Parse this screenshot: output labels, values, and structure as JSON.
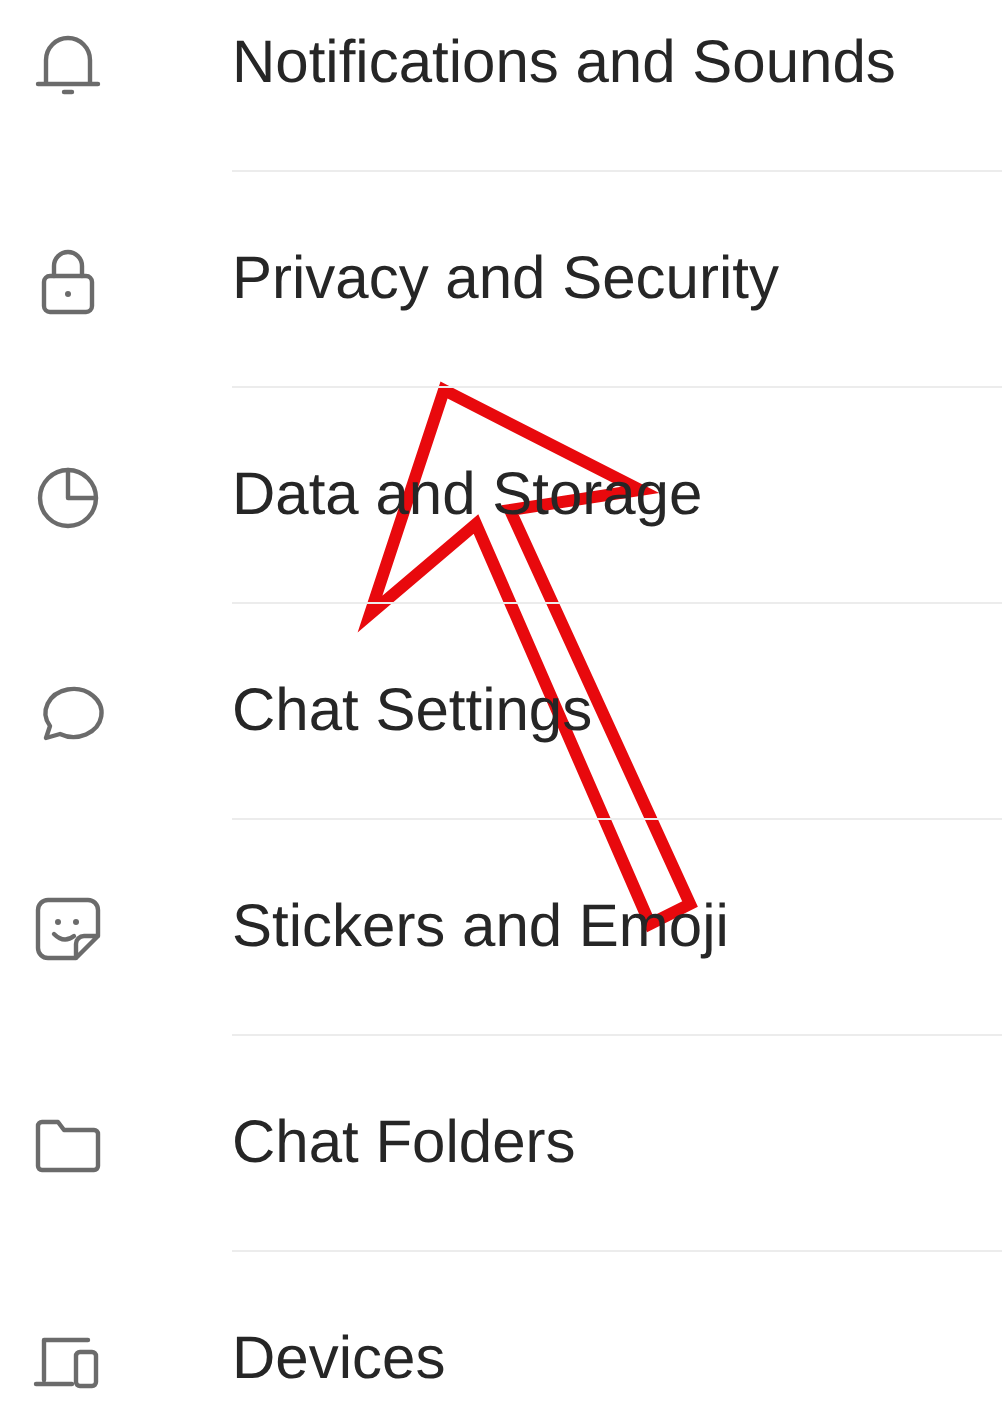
{
  "settings": {
    "items": [
      {
        "label": "Notifications and Sounds"
      },
      {
        "label": "Privacy and Security"
      },
      {
        "label": "Data and Storage"
      },
      {
        "label": "Chat Settings"
      },
      {
        "label": "Stickers and Emoji"
      },
      {
        "label": "Chat Folders"
      },
      {
        "label": "Devices"
      }
    ]
  }
}
